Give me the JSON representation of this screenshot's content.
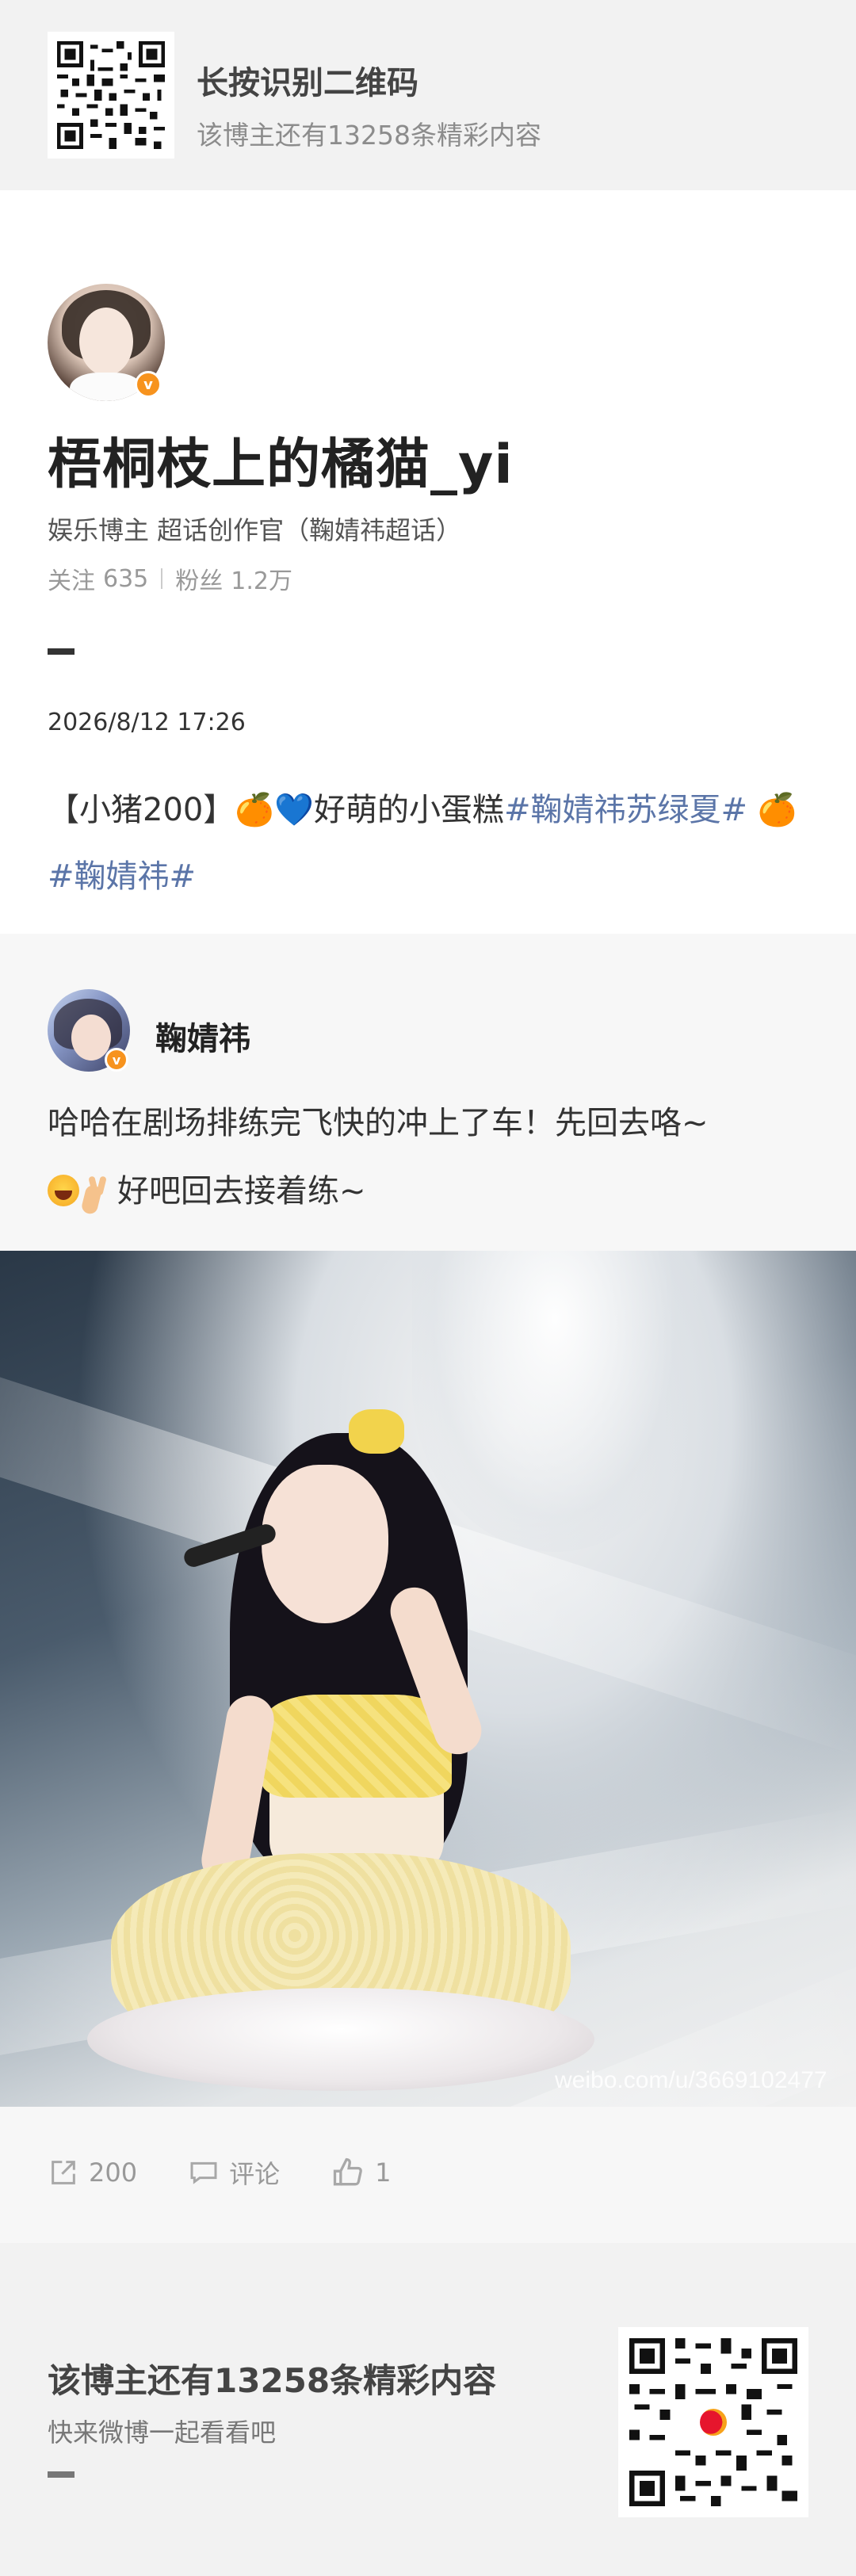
{
  "banner": {
    "title": "长按识别二维码",
    "subtitle": "该博主还有13258条精彩内容"
  },
  "profile": {
    "name": "梧桐枝上的橘猫_yi",
    "description": "娱乐博主 超话创作官（鞠婧祎超话）",
    "following_label": "关注",
    "following_count": "635",
    "followers_label": "粉丝",
    "followers_count": "1.2万"
  },
  "post": {
    "time": "2026/8/12 17:26",
    "text_prefix": "【小猪200】",
    "text_emojis_1": "🍊💙",
    "text_main": "好萌的小蛋糕",
    "hashtag_1": "#鞠婧祎苏绿夏#",
    "text_emojis_2": "🍊",
    "hashtag_2": "#鞠婧祎#"
  },
  "repost": {
    "author": "鞠婧祎",
    "text_line1": "哈哈在剧场排练完飞快的冲上了车！先回去咯~",
    "text_line2": "好吧回去接着练~",
    "photo_watermark": "weibo.com/u/3669102477"
  },
  "actions": {
    "reposts": "200",
    "comment_label": "评论",
    "likes": "1"
  },
  "footer": {
    "title": "该博主还有13258条精彩内容",
    "subtitle": "快来微博一起看看吧"
  },
  "icons": {
    "repost": "share-icon",
    "comment": "comment-icon",
    "like": "thumbs-up-icon",
    "verified": "verified-badge-icon"
  },
  "colors": {
    "hashtag": "#5b75a8",
    "verified_badge": "#f7931e"
  }
}
